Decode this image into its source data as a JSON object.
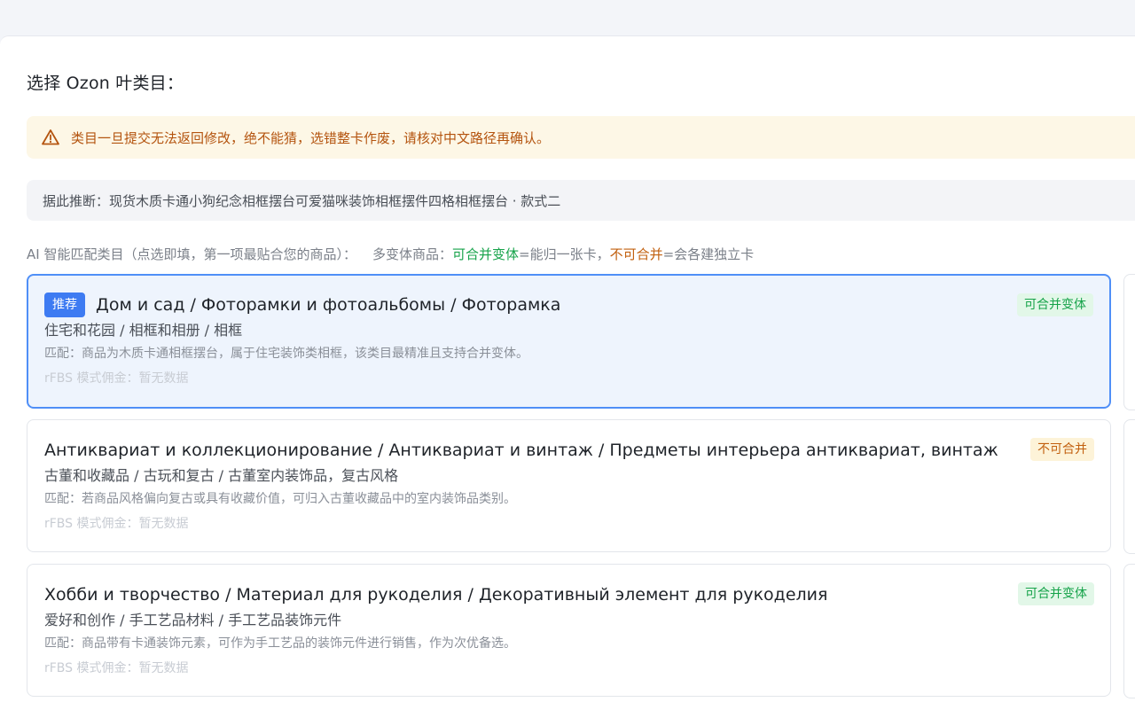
{
  "section_title": "选择 Ozon 叶类目：",
  "warning": {
    "icon": "warning-triangle-icon",
    "text": "类目一旦提交无法返回修改，绝不能猜，选错整卡作废，请核对中文路径再确认。",
    "color": "#b4540f"
  },
  "inference": {
    "text": "据此推断：现货木质卡通小狗纪念相框摆台可爱猫咪装饰相框摆件四格相框摆台 · 款式二"
  },
  "hint": {
    "prefix": "AI 智能匹配类目（点选即填，第一项最贴合您的商品）：",
    "variant_label": "多变体商品：",
    "merge_label": "可合并变体",
    "merge_desc": "=能归一张卡，",
    "nomerge_label": "不可合并",
    "nomerge_desc": "=会各建独立卡"
  },
  "colors": {
    "accent": "#3e7bf2",
    "selected_border": "#4f8ff7",
    "merge_green": "#16a34a",
    "nomerge_orange": "#c2600f"
  },
  "candidates": [
    {
      "recommended_label": "推荐",
      "ru_path": "Дом и сад / Фоторамки и фотоальбомы / Фоторамка",
      "cn_path": "住宅和花园 / 相框和相册 / 相框",
      "match": "匹配：商品为木质卡通相框摆台，属于住宅装饰类相框，该类目最精准且支持合并变体。",
      "commission": "rFBS 模式佣金：暂无数据",
      "tag": "可合并变体",
      "selected": true
    },
    {
      "ru_path": "Антиквариат и коллекционирование / Антиквариат и винтаж / Предметы интерьера антиквариат, винтаж",
      "cn_path": "古董和收藏品 / 古玩和复古 / 古董室内装饰品，复古风格",
      "match": "匹配：若商品风格偏向复古或具有收藏价值，可归入古董收藏品中的室内装饰品类别。",
      "commission": "rFBS 模式佣金：暂无数据",
      "tag": "不可合并",
      "selected": false
    },
    {
      "ru_path": "Хобби и творчество / Материал для рукоделия / Декоративный элемент для рукоделия",
      "cn_path": "爱好和创作 / 手工艺品材料 / 手工艺品装饰元件",
      "match": "匹配：商品带有卡通装饰元素，可作为手工艺品的装饰元件进行销售，作为次优备选。",
      "commission": "rFBS 模式佣金：暂无数据",
      "tag": "可合并变体",
      "selected": false
    }
  ]
}
